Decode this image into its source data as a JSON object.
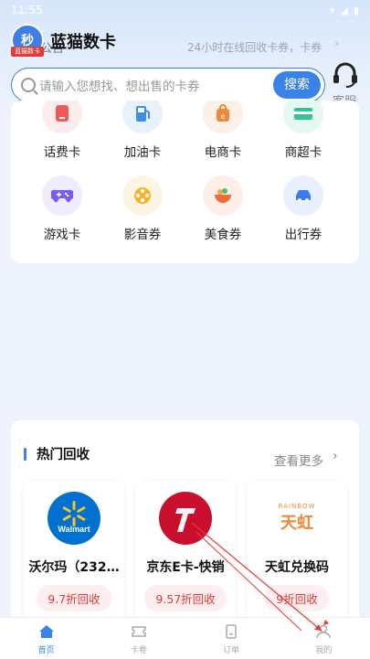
{
  "status": {
    "time": "11:55"
  },
  "header": {
    "logo_text": "秒",
    "logo_ribbon": "蓝猫数卡",
    "app_title": "蓝猫数卡",
    "notice_label": "公告",
    "notice_text": "24小时在线回收卡券，卡券"
  },
  "search": {
    "placeholder": "请输入您想找、想出售的卡券",
    "button": "搜索"
  },
  "service": {
    "label": "客服"
  },
  "categories": [
    {
      "label": "话费卡",
      "icon": "phone-card-icon",
      "bg": "#fdecec",
      "fg": "#f0585a"
    },
    {
      "label": "加油卡",
      "icon": "fuel-icon",
      "bg": "#e8f2fd",
      "fg": "#3a90f0"
    },
    {
      "label": "电商卡",
      "icon": "shopping-icon",
      "bg": "#fdf0e6",
      "fg": "#f08a3a"
    },
    {
      "label": "商超卡",
      "icon": "card-icon",
      "bg": "#e6f8f2",
      "fg": "#33c39a"
    },
    {
      "label": "游戏卡",
      "icon": "gamepad-icon",
      "bg": "#eeecfd",
      "fg": "#7a5cf0"
    },
    {
      "label": "影音券",
      "icon": "film-reel-icon",
      "bg": "#fdf5e3",
      "fg": "#f5b52a"
    },
    {
      "label": "美食券",
      "icon": "food-bowl-icon",
      "bg": "#fdeee8",
      "fg": "#f06a3a"
    },
    {
      "label": "出行券",
      "icon": "car-icon",
      "bg": "#e8f0fd",
      "fg": "#3a7af0"
    }
  ],
  "hot": {
    "title": "热门回收",
    "more": "查看更多",
    "products": [
      {
        "name": "沃尔玛（232…",
        "rate": "9.7折回收",
        "logo": "Walmart"
      },
      {
        "name": "京东E卡-快销",
        "rate": "9.57折回收",
        "logo": "JD"
      },
      {
        "name": "天虹兑换码",
        "rate": "9折回收",
        "logo": "天虹",
        "logo_top": "RAINBOW"
      }
    ]
  },
  "tabs": [
    {
      "label": "首页",
      "icon": "home-icon",
      "active": true
    },
    {
      "label": "卡卷",
      "icon": "ticket-icon",
      "active": false
    },
    {
      "label": "订单",
      "icon": "order-icon",
      "active": false
    },
    {
      "label": "我的",
      "icon": "user-icon",
      "active": false
    }
  ],
  "colors": {
    "accent": "#3a82e8",
    "price_red": "#e53935"
  }
}
